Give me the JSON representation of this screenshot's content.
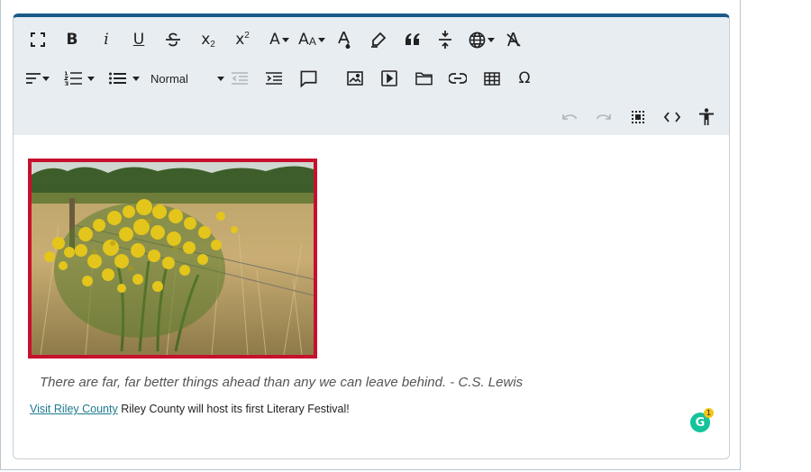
{
  "toolbar": {
    "row1": [
      "fullscreen-icon",
      "bold-icon",
      "italic-icon",
      "underline-icon",
      "strikethrough-icon",
      "subscript-icon",
      "superscript-icon",
      "font-family-icon",
      "font-size-icon",
      "text-color-icon",
      "highlight-icon",
      "blockquote-icon",
      "horizontal-rule-icon",
      "language-icon",
      "clear-formatting-icon"
    ],
    "row2": [
      "align-icon",
      "ordered-list-icon",
      "bullet-list-icon",
      "outdent-icon",
      "indent-icon",
      "comment-icon",
      "image-icon",
      "media-icon",
      "file-icon",
      "link-icon",
      "table-icon",
      "special-character-icon"
    ],
    "row3": [
      "undo-icon",
      "redo-icon",
      "select-all-icon",
      "source-code-icon",
      "accessibility-icon"
    ],
    "format_value": "Normal",
    "icons_text": {
      "italic": "i",
      "omega": "Ω",
      "bold": "B",
      "underline": "U",
      "sub": "x",
      "sub_n": "2",
      "sup": "x",
      "sup_n": "2",
      "font_a": "A",
      "font_aa_big": "A",
      "font_aa_small": "A"
    }
  },
  "content": {
    "image_alt": "Yellow ragwort flowers in a dry grass field beside a wire fence",
    "quote": "There are far, far better things ahead than any we can leave behind. - C.S. Lewis",
    "link_text": "Visit Riley County",
    "paragraph_rest": " Riley County will host its first Literary Festival!"
  },
  "grammarly": {
    "letter": "G",
    "badge_count": "1"
  },
  "colors": {
    "accent": "#1b5a8a",
    "toolbar_bg": "#e8edf1",
    "image_border": "#c8102e",
    "link": "#1b7a8f",
    "grammarly": "#15c39a"
  }
}
